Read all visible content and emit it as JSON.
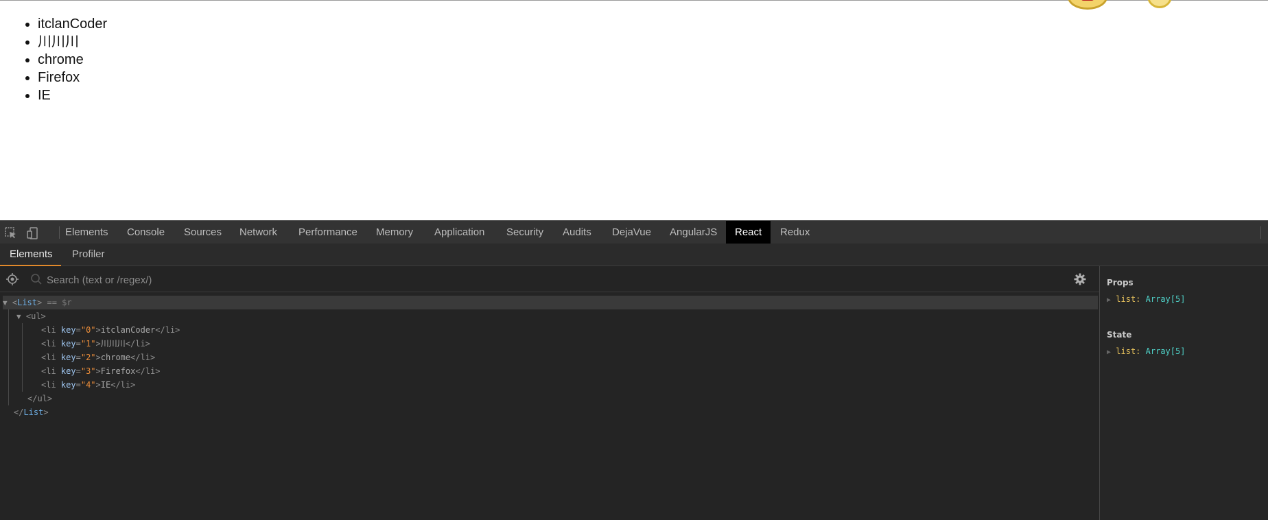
{
  "page": {
    "list_items": [
      "itclanCoder",
      "川川川",
      "chrome",
      "Firefox",
      "IE"
    ]
  },
  "devtools": {
    "tabs": [
      "Elements",
      "Console",
      "Sources",
      "Network",
      "Performance",
      "Memory",
      "Application",
      "Security",
      "Audits",
      "DejaVue",
      "AngularJS",
      "React",
      "Redux"
    ],
    "active_tab": "React",
    "subtabs": [
      "Elements",
      "Profiler"
    ],
    "active_subtab": "Elements",
    "search": {
      "placeholder": "Search (text or /regex/)",
      "value": ""
    },
    "tree": {
      "root_tag": "List",
      "root_suffix": "== $r",
      "ul_tag": "ul",
      "items": [
        {
          "key": "0",
          "text": "itclanCoder"
        },
        {
          "key": "1",
          "text": "川川川"
        },
        {
          "key": "2",
          "text": "chrome"
        },
        {
          "key": "3",
          "text": "Firefox"
        },
        {
          "key": "4",
          "text": "IE"
        }
      ]
    },
    "panel": {
      "props_title": "Props",
      "props": [
        {
          "key": "list",
          "value": "Array[5]"
        }
      ],
      "state_title": "State",
      "state": [
        {
          "key": "list",
          "value": "Array[5]"
        }
      ]
    }
  }
}
